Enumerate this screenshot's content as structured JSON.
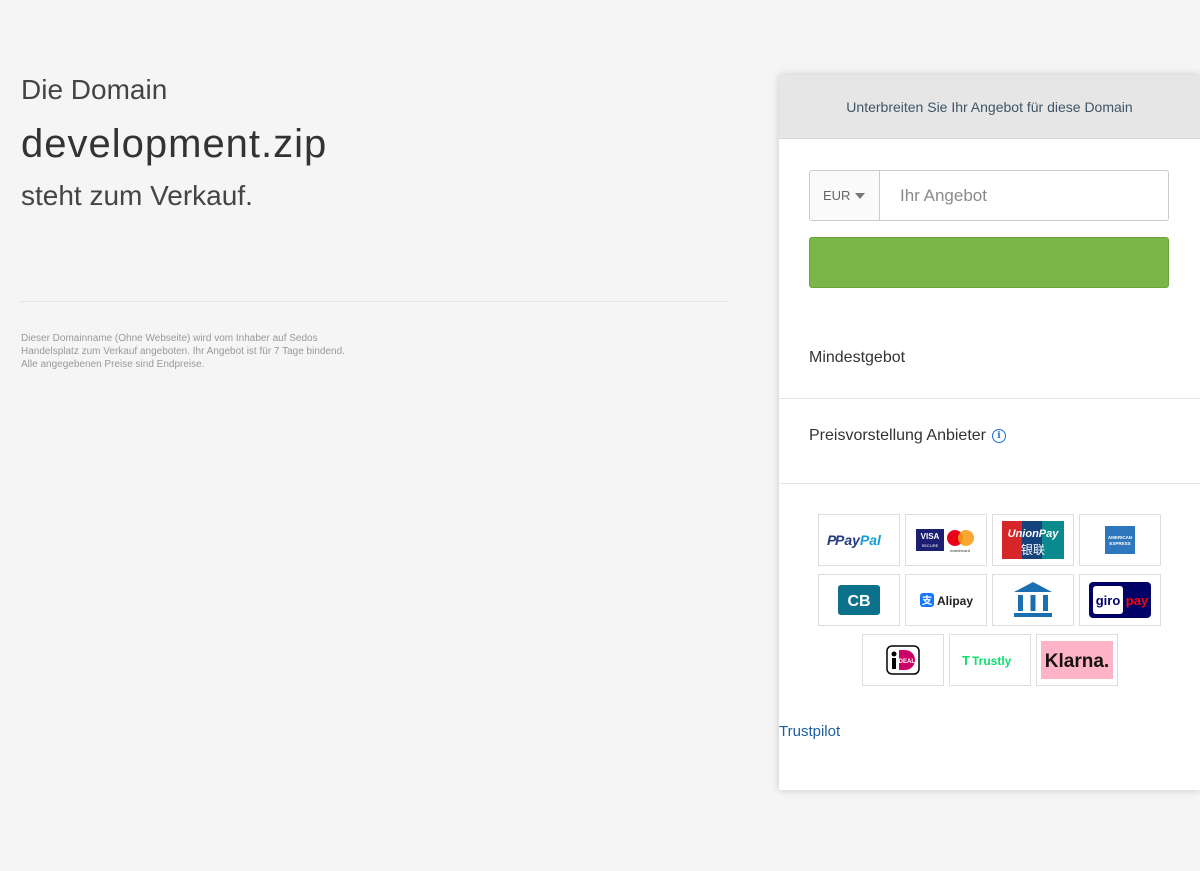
{
  "left": {
    "intro": "Die Domain",
    "domain": "development.zip",
    "sale": "steht zum Verkauf.",
    "disclaimer": "Dieser Domainname (Ohne Webseite) wird vom Inhaber auf Sedos Handelsplatz zum Verkauf angeboten. Ihr Angebot ist für 7 Tage bindend. Alle angegebenen Preise sind Endpreise."
  },
  "panel": {
    "header": "Unterbreiten Sie Ihr Angebot für diese Domain",
    "currency": "EUR",
    "offer_placeholder": "Ihr Angebot",
    "min_bid_label": "Mindestgebot",
    "price_label": "Preisvorstellung Anbieter",
    "trustpilot": "Trustpilot"
  },
  "payment": {
    "paypal": "PayPal",
    "visa": "VISA",
    "mastercard": "mastercard",
    "unionpay": "UnionPay",
    "unionpay_cn": "银联",
    "amex": "AMERICAN EXPRESS",
    "cb": "CB",
    "alipay": "Alipay",
    "giropay_a": "giro",
    "giropay_b": "pay",
    "ideal": "iDEAL",
    "trustly": "Trustly",
    "klarna": "Klarna."
  },
  "colors": {
    "button_green": "#7ab648",
    "link_blue": "#1d5fa0",
    "header_gray": "#e6e6e6"
  }
}
